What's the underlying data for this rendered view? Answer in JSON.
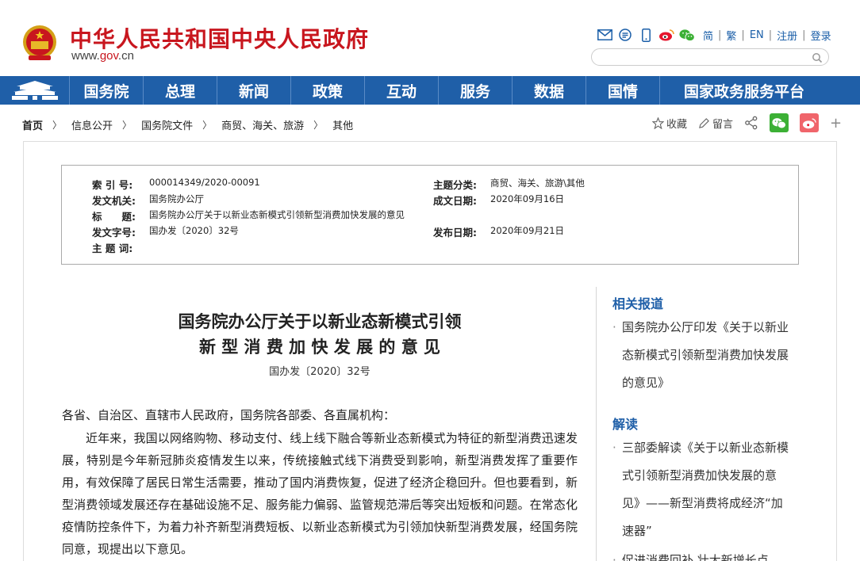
{
  "site": {
    "title": "中华人民共和国中央人民政府",
    "url_prefix": "www.",
    "url_mid": "gov",
    "url_suffix": ".cn"
  },
  "top_links": [
    "简",
    "繁",
    "EN",
    "注册",
    "登录"
  ],
  "search": {
    "placeholder": ""
  },
  "nav": [
    "国务院",
    "总理",
    "新闻",
    "政策",
    "互动",
    "服务",
    "数据",
    "国情",
    "国家政务服务平台"
  ],
  "breadcrumb": [
    "首页",
    "信息公开",
    "国务院文件",
    "商贸、海关、旅游",
    "其他"
  ],
  "share": {
    "collect": "收藏",
    "comment": "留言"
  },
  "meta": {
    "index_label": "索 引 号:",
    "index_value": "000014349/2020-00091",
    "topic_label": "主题分类:",
    "topic_value": "商贸、海关、旅游\\其他",
    "issuer_label": "发文机关:",
    "issuer_value": "国务院办公厅",
    "date_label": "成文日期:",
    "date_value": "2020年09月16日",
    "title_label": "标　　题:",
    "title_value": "国务院办公厅关于以新业态新模式引领新型消费加快发展的意见",
    "docno_label": "发文字号:",
    "docno_value": "国办发〔2020〕32号",
    "pub_label": "发布日期:",
    "pub_value": "2020年09月21日",
    "keywords_label": "主 题 词:"
  },
  "article": {
    "title_line1": "国务院办公厅关于以新业态新模式引领",
    "title_line2": "新 型 消 费 加 快 发 展 的 意 见",
    "doc_no": "国办发〔2020〕32号",
    "salutation": "各省、自治区、直辖市人民政府，国务院各部委、各直属机构：",
    "paragraph1": "近年来，我国以网络购物、移动支付、线上线下融合等新业态新模式为特征的新型消费迅速发展，特别是今年新冠肺炎疫情发生以来，传统接触式线下消费受到影响，新型消费发挥了重要作用，有效保障了居民日常生活需要，推动了国内消费恢复，促进了经济企稳回升。但也要看到，新型消费领域发展还存在基础设施不足、服务能力偏弱、监管规范滞后等突出短板和问题。在常态化疫情防控条件下，为着力补齐新型消费短板、以新业态新模式为引领加快新型消费发展，经国务院同意，现提出以下意见。"
  },
  "sidebar": {
    "related_heading": "相关报道",
    "related_item": "国务院办公厅印发《关于以新业态新模式引领新型消费加快发展的意见》",
    "interpret_heading": "解读",
    "interpret_item": "三部委解读《关于以新业态新模式引领新型消费加快发展的意见》——新型消费将成经济“加速器”",
    "partial_item": "促进消费回补 壮大新增长点"
  },
  "colors": {
    "brand_red": "#c8161e",
    "nav_blue": "#1f5fa8",
    "wechat_green": "#3cb035",
    "weibo_red": "#e6162d"
  }
}
